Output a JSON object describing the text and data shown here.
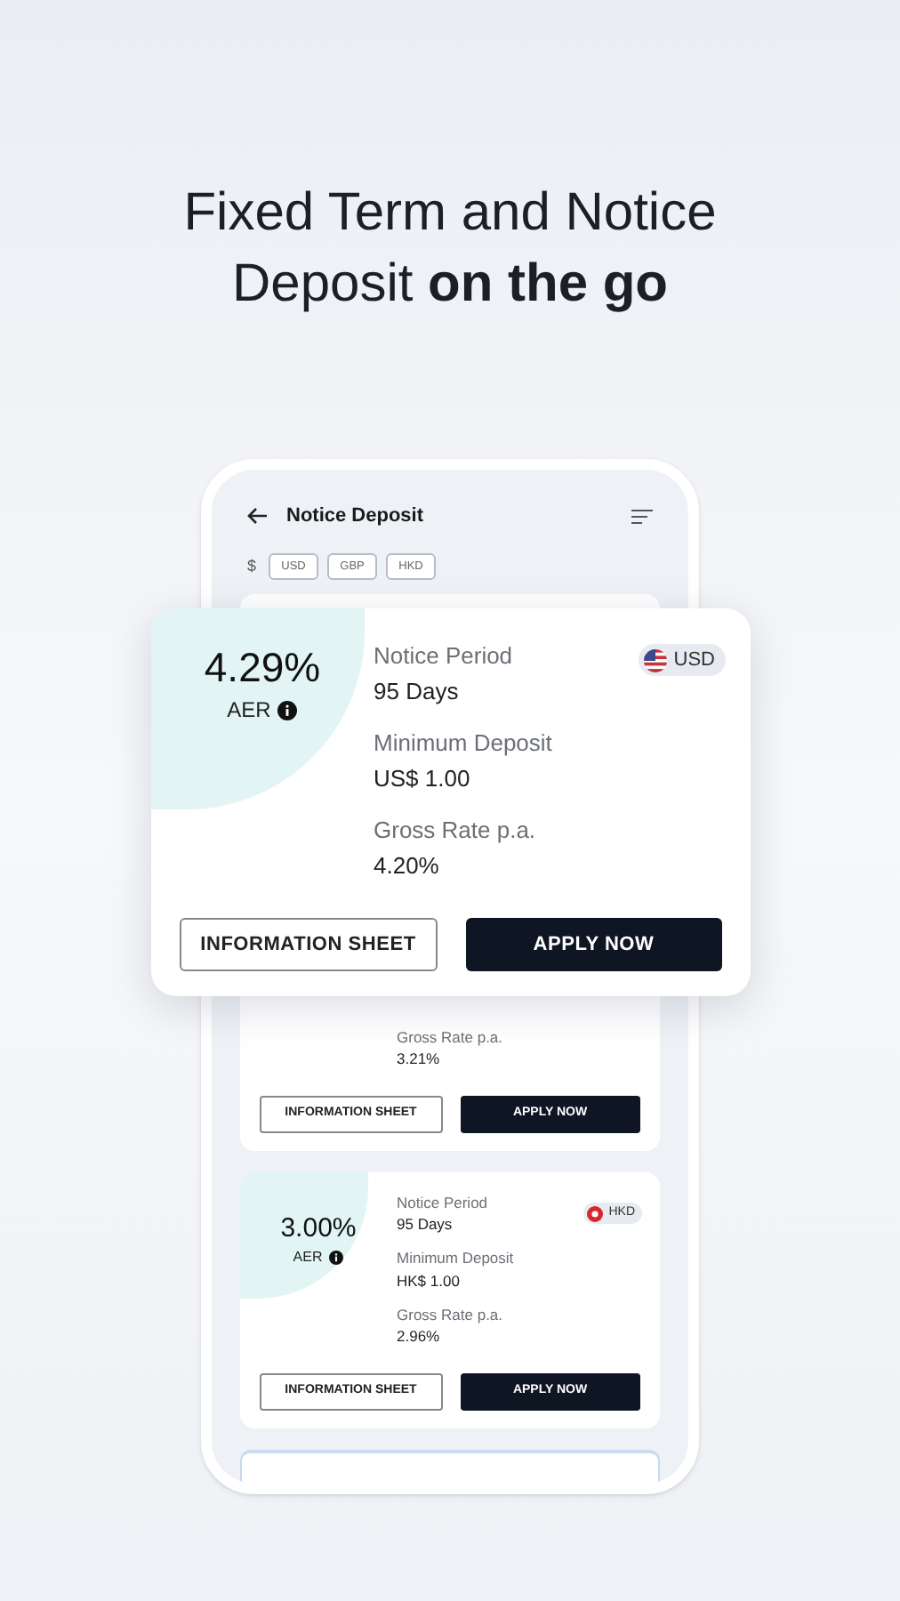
{
  "headline": {
    "line_1": "Fixed Term and Notice",
    "line_2": "Deposit **on the go**"
  },
  "screen": {
    "title": "Notice Deposit",
    "currency_label": "$",
    "currency_chips": [
      "USD",
      "GBP",
      "HKD"
    ],
    "cards": [
      {
        "kind": "partial",
        "fields": [
          {
            "label": "Gross Rate p.a.",
            "value": "3.21%"
          }
        ],
        "info_button": "INFORMATION SHEET",
        "apply_button": "APPLY NOW"
      },
      {
        "kind": "full",
        "rate": "3.00%",
        "rate_label": "AER",
        "currency": "HKD",
        "fields": [
          {
            "label": "Notice Period",
            "value": "95 Days"
          },
          {
            "label": "Minimum Deposit",
            "value": "HK$ 1.00"
          },
          {
            "label": "Gross Rate p.a.",
            "value": "2.96%"
          }
        ],
        "info_button": "INFORMATION SHEET",
        "apply_button": "APPLY NOW"
      }
    ]
  },
  "featured_card": {
    "rate": "4.29%",
    "rate_label": "AER",
    "currency": "USD",
    "fields": [
      {
        "label": "Notice Period",
        "value": "95 Days"
      },
      {
        "label": "Minimum Deposit",
        "value": "US$ 1.00"
      },
      {
        "label": "Gross Rate p.a.",
        "value": "4.20%"
      }
    ],
    "info_button": "INFORMATION SHEET",
    "apply_button": "APPLY NOW"
  }
}
